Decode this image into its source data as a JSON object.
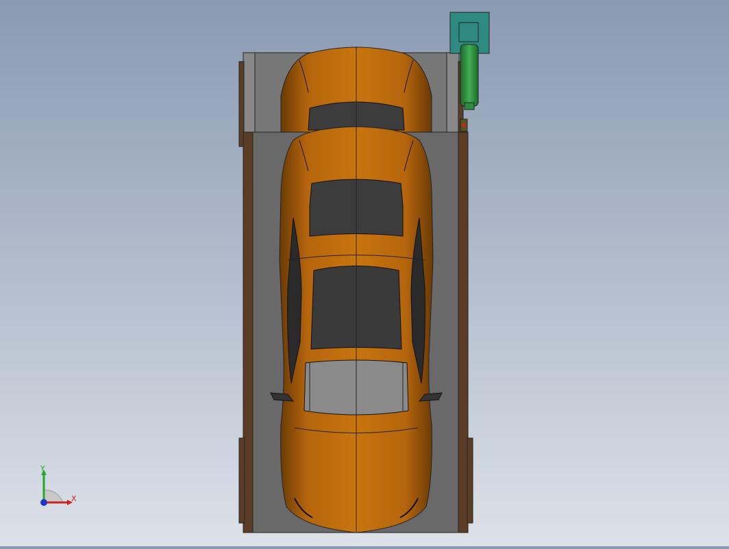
{
  "viewport": {
    "background_top": "#8a9ab3",
    "background_bottom": "#dde1e8"
  },
  "model": {
    "car_color": "#b5650c",
    "car_shadow": "#6a3a05",
    "glass_color": "#3c3c3c",
    "platform_color": "#6e6e6e",
    "frame_color": "#5a3d24",
    "column_color": "#2e8b3e",
    "column_head_color": "#2f8a82"
  },
  "triad": {
    "x_label": "X",
    "y_label": "Y",
    "x_color": "#cc2222",
    "y_color": "#22aa22",
    "z_color": "#2233cc"
  }
}
